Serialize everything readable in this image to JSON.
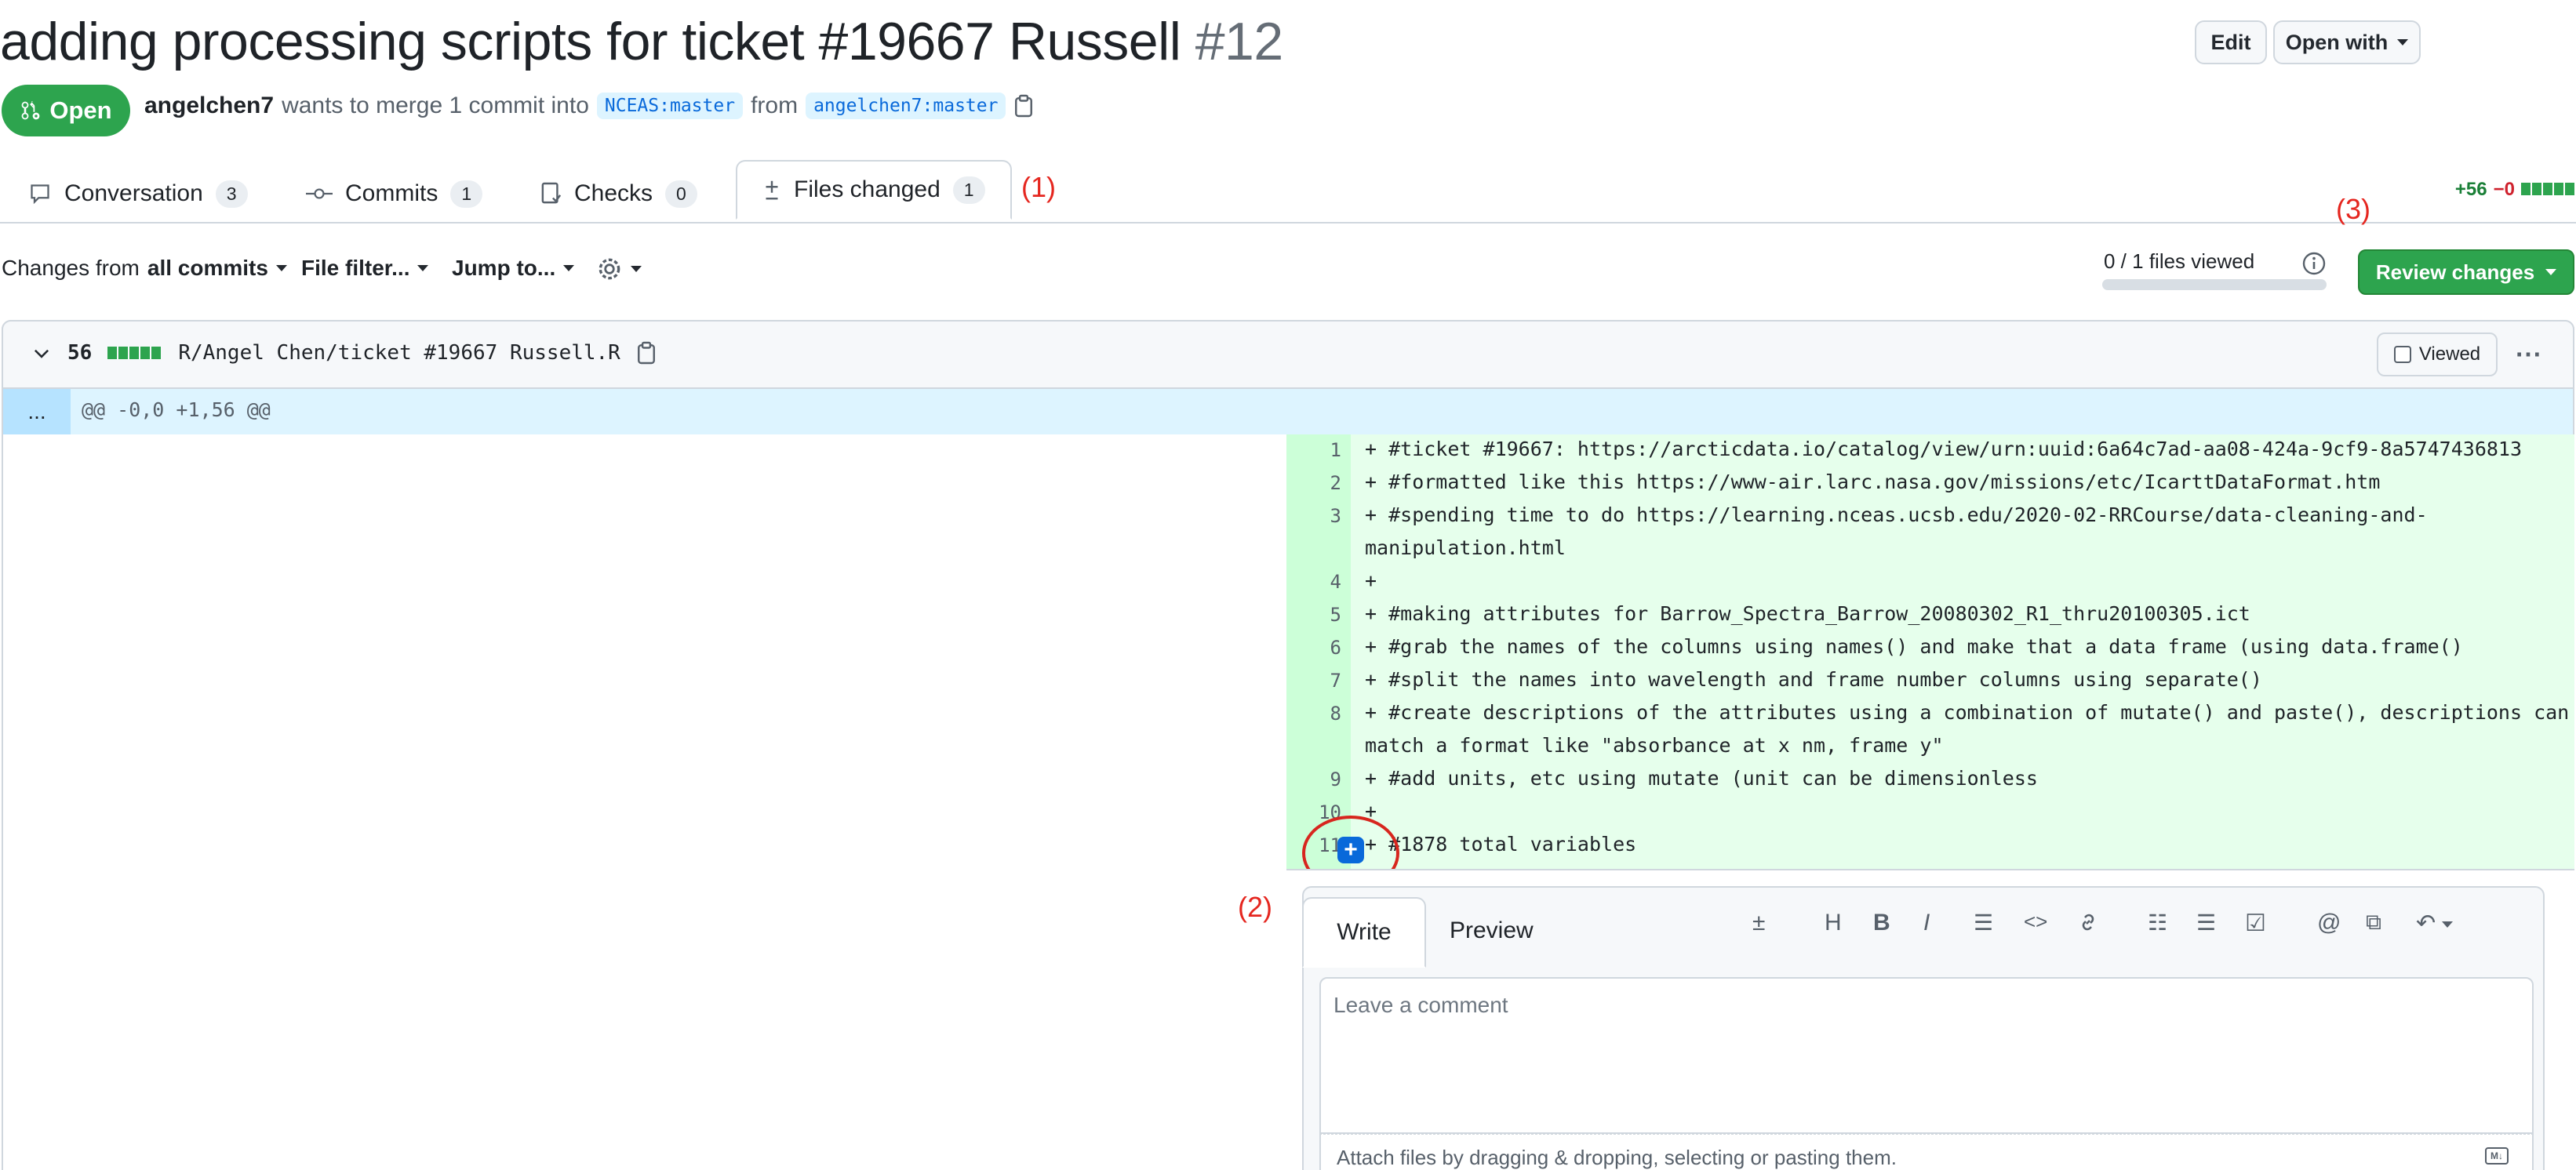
{
  "pr": {
    "title": "adding processing scripts for ticket #19667 Russell",
    "number": "#12",
    "state": "Open",
    "author": "angelchen7",
    "action_text": "wants to merge 1 commit into",
    "base_branch": "NCEAS:master",
    "from_text": "from",
    "head_branch": "angelchen7:master",
    "edit_label": "Edit",
    "open_with_label": "Open with"
  },
  "tabs": [
    {
      "label": "Conversation",
      "count": "3"
    },
    {
      "label": "Commits",
      "count": "1"
    },
    {
      "label": "Checks",
      "count": "0"
    },
    {
      "label": "Files changed",
      "count": "1"
    }
  ],
  "annotations": {
    "a1": "(1)",
    "a2": "(2)",
    "a3": "(3)"
  },
  "diffstat": {
    "additions": "+56",
    "deletions": "−0"
  },
  "toolbar": {
    "changes_from": "Changes from",
    "all_commits": "all commits",
    "file_filter": "File filter...",
    "jump_to": "Jump to...",
    "files_viewed": "0 / 1 files viewed",
    "files_viewed_fraction": 0,
    "review_changes": "Review changes"
  },
  "file": {
    "changes": "56",
    "path": "R/Angel Chen/ticket #19667 Russell.R",
    "viewed_label": "Viewed",
    "hunk_expand": "...",
    "hunk_header": "@@ -0,0 +1,56 @@"
  },
  "lines": [
    {
      "n": "1",
      "text": "+ #ticket #19667: https://arcticdata.io/catalog/view/urn:uuid:6a64c7ad-aa08-424a-9cf9-8a5747436813",
      "cont": ""
    },
    {
      "n": "2",
      "text": "+ #formatted like this https://www-air.larc.nasa.gov/missions/etc/IcarttDataFormat.htm",
      "cont": ""
    },
    {
      "n": "3",
      "text": "+ #spending time to do https://learning.nceas.ucsb.edu/2020-02-RRCourse/data-cleaning-and-",
      "cont": "manipulation.html"
    },
    {
      "n": "4",
      "text": "+",
      "cont": ""
    },
    {
      "n": "5",
      "text": "+ #making attributes for Barrow_Spectra_Barrow_20080302_R1_thru20100305.ict",
      "cont": ""
    },
    {
      "n": "6",
      "text": "+ #grab the names of the columns using names() and make that a data frame (using data.frame()",
      "cont": ""
    },
    {
      "n": "7",
      "text": "+ #split the names into wavelength and frame number columns using separate()",
      "cont": ""
    },
    {
      "n": "8",
      "text": "+ #create descriptions of the attributes using a combination of mutate() and paste(), descriptions can",
      "cont": "match a format like \"absorbance at x nm, frame y\""
    },
    {
      "n": "9",
      "text": "+ #add units, etc using mutate (unit can be dimensionless",
      "cont": ""
    },
    {
      "n": "10",
      "text": "+",
      "cont": ""
    },
    {
      "n": "11",
      "text": "+ #1878 total variables",
      "cont": ""
    }
  ],
  "comment": {
    "write_tab": "Write",
    "preview_tab": "Preview",
    "placeholder": "Leave a comment",
    "attach_hint": "Attach files by dragging & dropping, selecting or pasting them.",
    "md_badge": "M↓"
  }
}
